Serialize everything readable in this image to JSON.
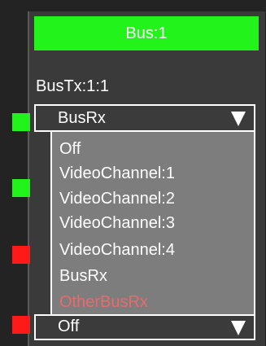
{
  "header": {
    "title": "Bus:1"
  },
  "bus_tx": {
    "label": "BusTx:1:1"
  },
  "selector_top": {
    "value": "BusRx"
  },
  "selector_bottom": {
    "value": "Off"
  },
  "dropdown": {
    "options": [
      "Off",
      "VideoChannel:1",
      "VideoChannel:2",
      "VideoChannel:3",
      "VideoChannel:4",
      "BusRx",
      "OtherBusRx"
    ]
  },
  "indicators": [
    {
      "color": "#22f31a"
    },
    {
      "color": "#22f31a"
    },
    {
      "color": "#ff1a1a"
    },
    {
      "color": "#ff1a1a"
    }
  ],
  "colors": {
    "accent": "#22f31a",
    "alert": "#ff1a1a",
    "highlight_text": "#e86b6b"
  }
}
